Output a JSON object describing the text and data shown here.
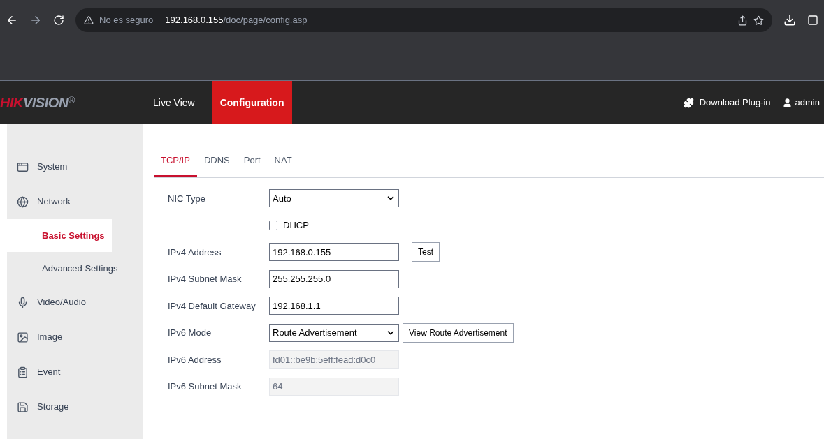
{
  "browser": {
    "security": "No es seguro",
    "url_host": "192.168.0.155",
    "url_path": "/doc/page/config.asp"
  },
  "header": {
    "logo_red": "HIK",
    "logo_gray": "VISION",
    "logo_mark": "®",
    "nav": [
      {
        "label": "Live View",
        "selected": false
      },
      {
        "label": "Configuration",
        "selected": true
      }
    ],
    "plugin": "Download Plug-in",
    "user": "admin"
  },
  "sidebar": [
    {
      "label": "System",
      "selected": false
    },
    {
      "label": "Network",
      "selected": false,
      "children": [
        {
          "label": "Basic Settings",
          "selected": true
        },
        {
          "label": "Advanced Settings",
          "selected": false
        }
      ]
    },
    {
      "label": "Video/Audio",
      "selected": false
    },
    {
      "label": "Image",
      "selected": false
    },
    {
      "label": "Event",
      "selected": false
    },
    {
      "label": "Storage",
      "selected": false
    }
  ],
  "tabs": [
    {
      "label": "TCP/IP",
      "selected": true
    },
    {
      "label": "DDNS",
      "selected": false
    },
    {
      "label": "Port",
      "selected": false
    },
    {
      "label": "NAT",
      "selected": false
    }
  ],
  "form": [
    {
      "kind": "select",
      "label": "NIC Type",
      "value": "Auto"
    },
    {
      "kind": "checkbox",
      "label": "DHCP",
      "checked": false
    },
    {
      "kind": "text",
      "label": "IPv4 Address",
      "value": "192.168.0.155",
      "button": "Test"
    },
    {
      "kind": "text",
      "label": "IPv4 Subnet Mask",
      "value": "255.255.255.0"
    },
    {
      "kind": "text",
      "label": "IPv4 Default Gateway",
      "value": "192.168.1.1"
    },
    {
      "kind": "select",
      "label": "IPv6 Mode",
      "value": "Route Advertisement",
      "button": "View Route Advertisement"
    },
    {
      "kind": "readonly",
      "label": "IPv6 Address",
      "value": "fd01::be9b:5eff:fead:d0c0"
    },
    {
      "kind": "readonly",
      "label": "IPv6 Subnet Mask",
      "value": "64"
    }
  ]
}
